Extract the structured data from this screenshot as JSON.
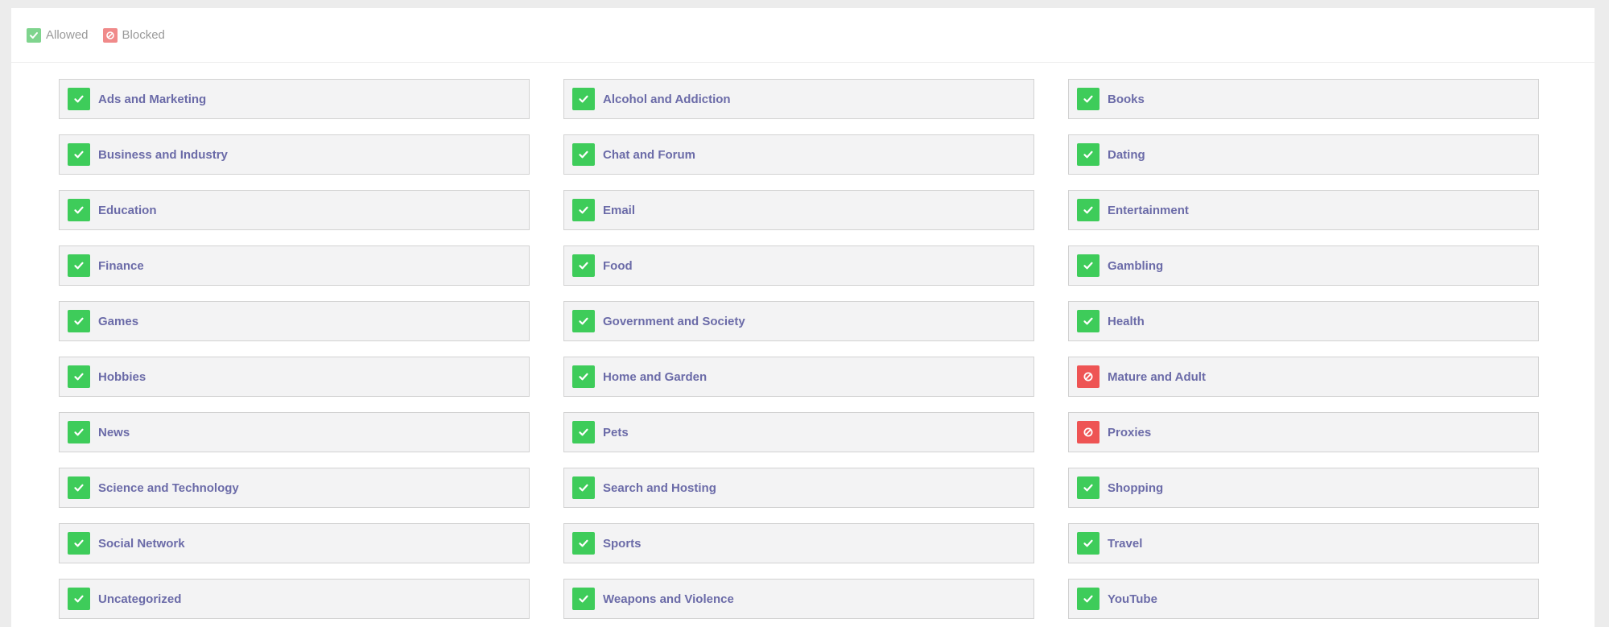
{
  "legend": {
    "allowed_label": "Allowed",
    "blocked_label": "Blocked"
  },
  "colors": {
    "allowed": "#3ecc5a",
    "blocked": "#ee5454",
    "label": "#6b6ba8"
  },
  "categories": [
    {
      "label": "Ads and Marketing",
      "status": "allowed"
    },
    {
      "label": "Alcohol and Addiction",
      "status": "allowed"
    },
    {
      "label": "Books",
      "status": "allowed"
    },
    {
      "label": "Business and Industry",
      "status": "allowed"
    },
    {
      "label": "Chat and Forum",
      "status": "allowed"
    },
    {
      "label": "Dating",
      "status": "allowed"
    },
    {
      "label": "Education",
      "status": "allowed"
    },
    {
      "label": "Email",
      "status": "allowed"
    },
    {
      "label": "Entertainment",
      "status": "allowed"
    },
    {
      "label": "Finance",
      "status": "allowed"
    },
    {
      "label": "Food",
      "status": "allowed"
    },
    {
      "label": "Gambling",
      "status": "allowed"
    },
    {
      "label": "Games",
      "status": "allowed"
    },
    {
      "label": "Government and Society",
      "status": "allowed"
    },
    {
      "label": "Health",
      "status": "allowed"
    },
    {
      "label": "Hobbies",
      "status": "allowed"
    },
    {
      "label": "Home and Garden",
      "status": "allowed"
    },
    {
      "label": "Mature and Adult",
      "status": "blocked"
    },
    {
      "label": "News",
      "status": "allowed"
    },
    {
      "label": "Pets",
      "status": "allowed"
    },
    {
      "label": "Proxies",
      "status": "blocked"
    },
    {
      "label": "Science and Technology",
      "status": "allowed"
    },
    {
      "label": "Search and Hosting",
      "status": "allowed"
    },
    {
      "label": "Shopping",
      "status": "allowed"
    },
    {
      "label": "Social Network",
      "status": "allowed"
    },
    {
      "label": "Sports",
      "status": "allowed"
    },
    {
      "label": "Travel",
      "status": "allowed"
    },
    {
      "label": "Uncategorized",
      "status": "allowed"
    },
    {
      "label": "Weapons and Violence",
      "status": "allowed"
    },
    {
      "label": "YouTube",
      "status": "allowed"
    }
  ]
}
